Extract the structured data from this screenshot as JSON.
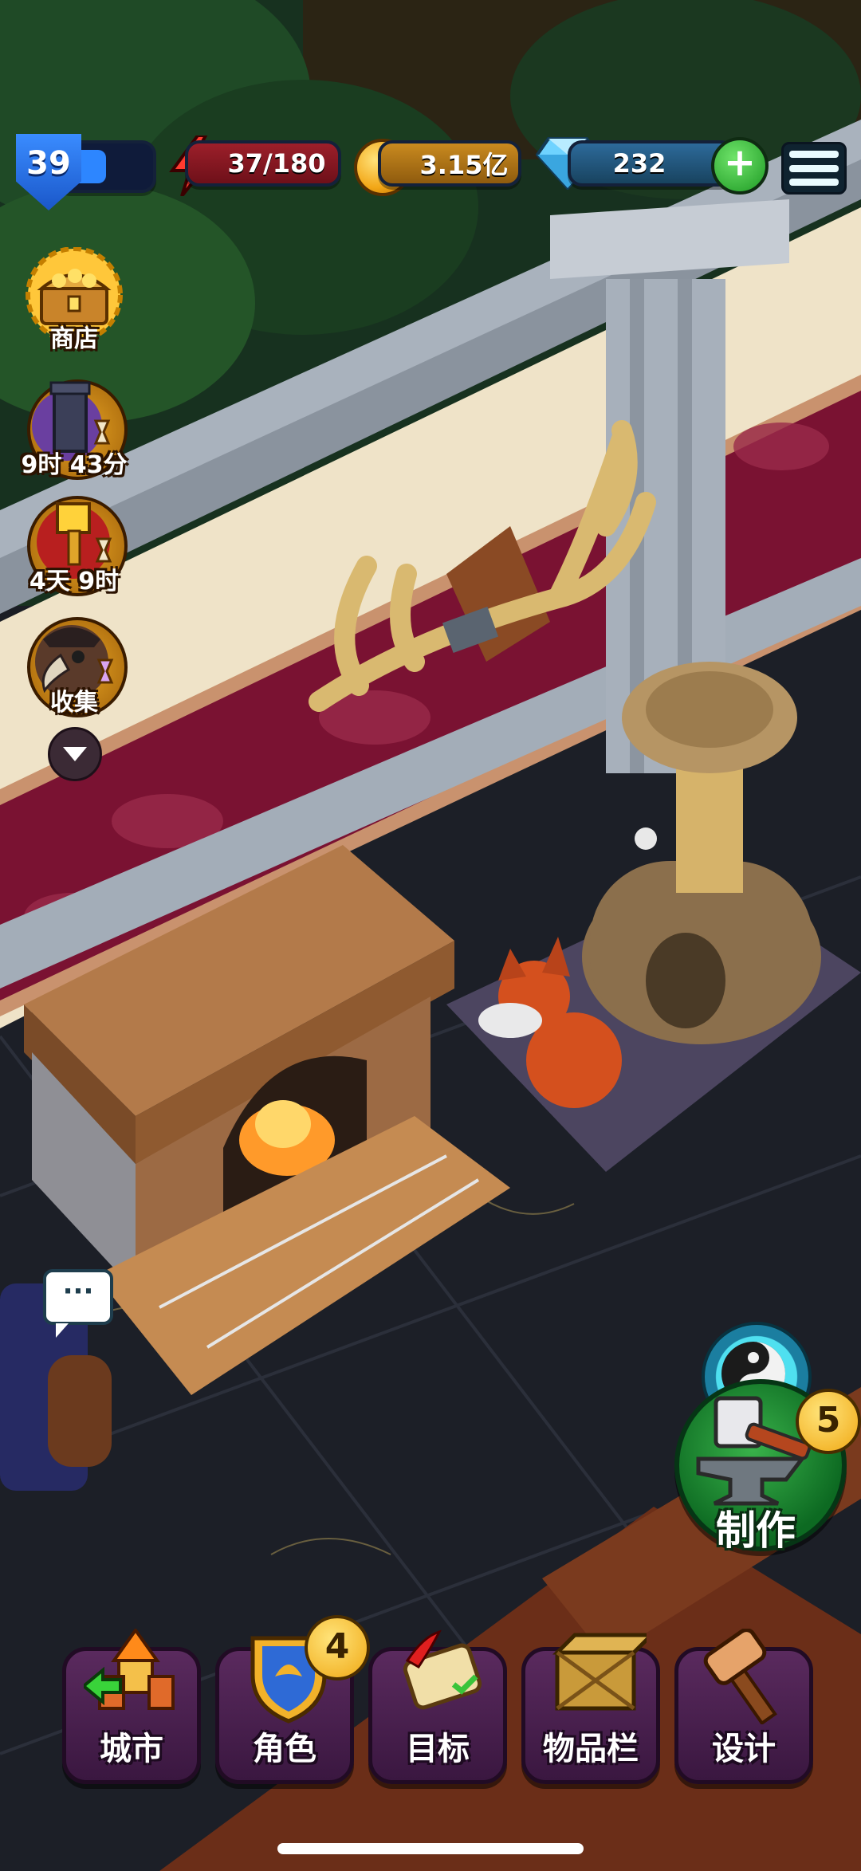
{
  "hud": {
    "level": "39",
    "level_progress": 0.45,
    "energy": "37/180",
    "gold": "3.15亿",
    "gems": "232",
    "add_gems_symbol": "+"
  },
  "left_column": {
    "shop_label": "商店",
    "tower_timer": "9时 43分",
    "hammer_timer": "4天 9时",
    "collect_label": "收集"
  },
  "craft": {
    "label": "制作",
    "badge": "5"
  },
  "bottom_nav": {
    "city": "城市",
    "role": "角色",
    "role_badge": "4",
    "goals": "目标",
    "inventory": "物品栏",
    "design": "设计"
  },
  "chat": {
    "symbol": "···"
  },
  "colors": {
    "wall_stripe": "#7a1232",
    "floor": "#1c1f27",
    "craft_green": "#1b8a2f",
    "nav_purple": "#4a1f4f",
    "level_blue": "#2d86ff"
  }
}
